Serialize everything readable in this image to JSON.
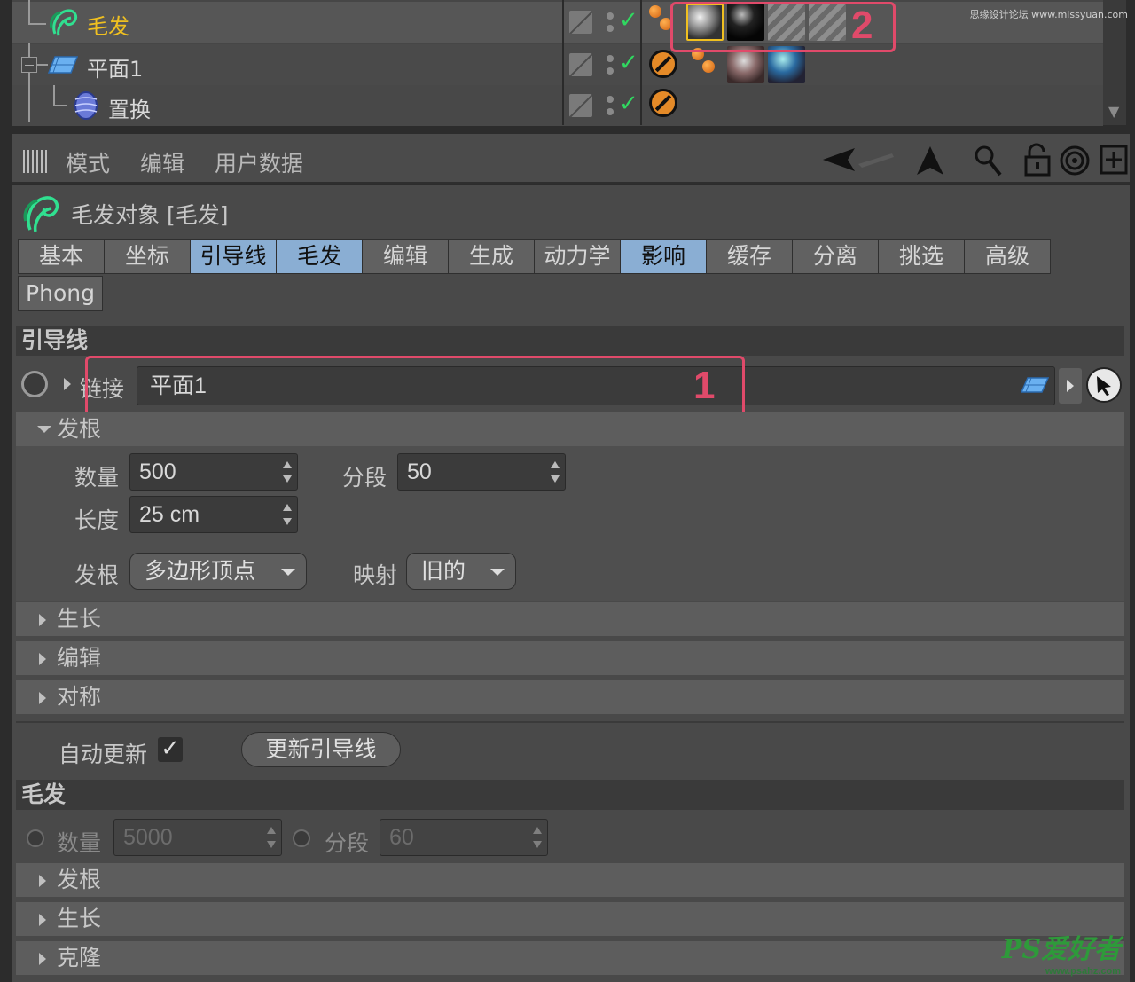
{
  "watermark_top": "思缘设计论坛 www.missyuan.com",
  "object_manager": {
    "rows": [
      {
        "name": "毛发",
        "icon": "hair-object-icon",
        "selected": true
      },
      {
        "name": "平面1",
        "icon": "plane-icon",
        "selected": false
      },
      {
        "name": "置换",
        "icon": "displace-deformer-icon",
        "selected": false
      }
    ],
    "annotation_2": "2"
  },
  "toolbar": {
    "menu": [
      "模式",
      "编辑",
      "用户数据"
    ]
  },
  "object_title": "毛发对象 [毛发]",
  "tabs": [
    {
      "label": "基本",
      "active": false
    },
    {
      "label": "坐标",
      "active": false
    },
    {
      "label": "引导线",
      "active": true
    },
    {
      "label": "毛发",
      "active": true
    },
    {
      "label": "编辑",
      "active": false
    },
    {
      "label": "生成",
      "active": false
    },
    {
      "label": "动力学",
      "active": false
    },
    {
      "label": "影响",
      "active": true
    },
    {
      "label": "缓存",
      "active": false
    },
    {
      "label": "分离",
      "active": false
    },
    {
      "label": "挑选",
      "active": false
    },
    {
      "label": "高级",
      "active": false
    },
    {
      "label": "Phong",
      "active": false
    }
  ],
  "guides": {
    "section_title": "引导线",
    "link_label": "链接",
    "link_value": "平面1",
    "annotation_1": "1",
    "root_group": "发根",
    "count_label": "数量",
    "count_value": "500",
    "segments_label": "分段",
    "segments_value": "50",
    "length_label": "长度",
    "length_value": "25 cm",
    "root_label": "发根",
    "root_value": "多边形顶点",
    "mapping_label": "映射",
    "mapping_value": "旧的",
    "groups": [
      "生长",
      "编辑",
      "对称"
    ],
    "auto_update_label": "自动更新",
    "auto_update_checked": true,
    "update_button": "更新引导线"
  },
  "hair": {
    "section_title": "毛发",
    "count_label": "数量",
    "count_value": "5000",
    "segments_label": "分段",
    "segments_value": "60",
    "groups": [
      "发根",
      "生长",
      "克隆"
    ]
  },
  "ps_watermark": "PS爱好者",
  "ps_watermark_url": "www.psahz.com",
  "colors": {
    "accent_tab": "#8aaed3",
    "selected_name": "#f0c020",
    "annotation": "#e04a6a",
    "check": "#30d860"
  }
}
